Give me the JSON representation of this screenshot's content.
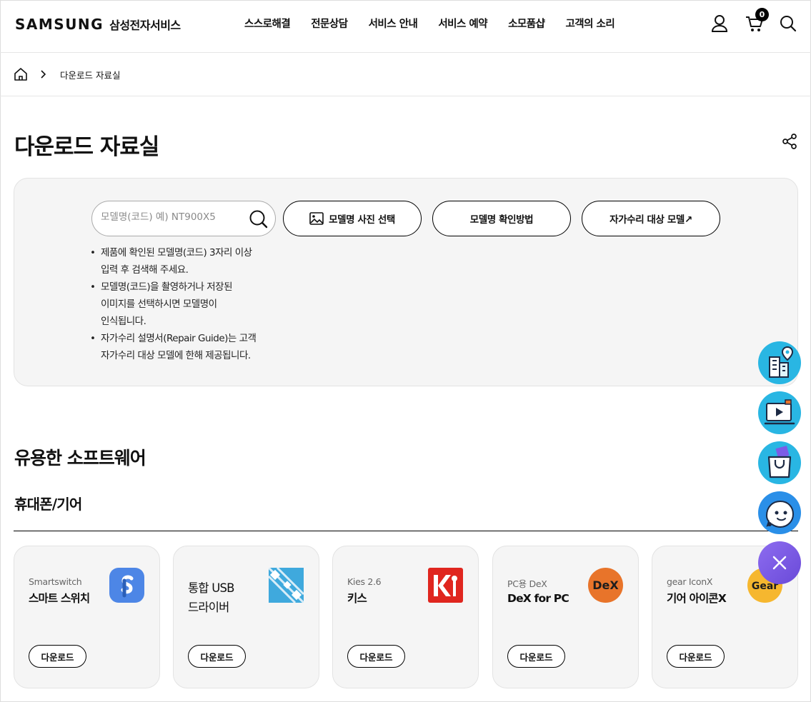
{
  "header": {
    "logo_word": "SAMSUNG",
    "logo_sub": "삼성전자서비스",
    "menu": [
      "스스로해결",
      "전문상담",
      "서비스 안내",
      "서비스 예약",
      "소모품샵",
      "고객의 소리"
    ],
    "cart_count": "0",
    "icons": [
      "user-icon",
      "cart-icon",
      "search-icon"
    ]
  },
  "breadcrumb": {
    "current": "다운로드 자료실"
  },
  "page": {
    "title": "다운로드 자료실"
  },
  "search": {
    "placeholder": "모델명(코드) 예) NT900X5",
    "value": "",
    "photo_button": "모델명 사진 선택",
    "howto_button": "모델명 확인방법",
    "self_repair_button": "자가수리 대상 모델↗"
  },
  "notes": [
    [
      "제품에 확인된 모델명(코드) 3자리 이상",
      "입력 후 검색해 주세요."
    ],
    [
      "모델명(코드)을 촬영하거나 저장된",
      "이미지를 선택하시면 모델명이",
      "인식됩니다."
    ],
    [
      "자가수리 설명서(Repair Guide)는 고객",
      "자가수리 대상 모델에 한해 제공됩니다."
    ]
  ],
  "software": {
    "section_title": "유용한 소프트웨어",
    "category_title": "휴대폰/기어",
    "download_label": "다운로드",
    "cards": [
      {
        "sub": "Smartswitch",
        "name": "스마트 스위치",
        "icon": "smartswitch-icon"
      },
      {
        "sub": "",
        "name_lines": [
          "통합 USB",
          "드라이버"
        ],
        "icon": "usb-driver-icon"
      },
      {
        "sub": "Kies 2.6",
        "name": "키스",
        "icon": "kies-icon"
      },
      {
        "sub": "PC용 DeX",
        "name": "DeX for PC",
        "icon": "dex-icon",
        "icon_text": "DeX"
      },
      {
        "sub": "gear IconX",
        "name": "기어 아이콘X",
        "icon": "gear-iconx-icon",
        "icon_text": "Gear"
      }
    ]
  },
  "quick_menu": {
    "items": [
      "service-center-icon",
      "video-guide-icon",
      "shop-bag-icon",
      "chatbot-icon",
      "close-icon"
    ],
    "colors": {
      "cyan": "#29b6e3",
      "purple": "#7b5ce6"
    }
  }
}
